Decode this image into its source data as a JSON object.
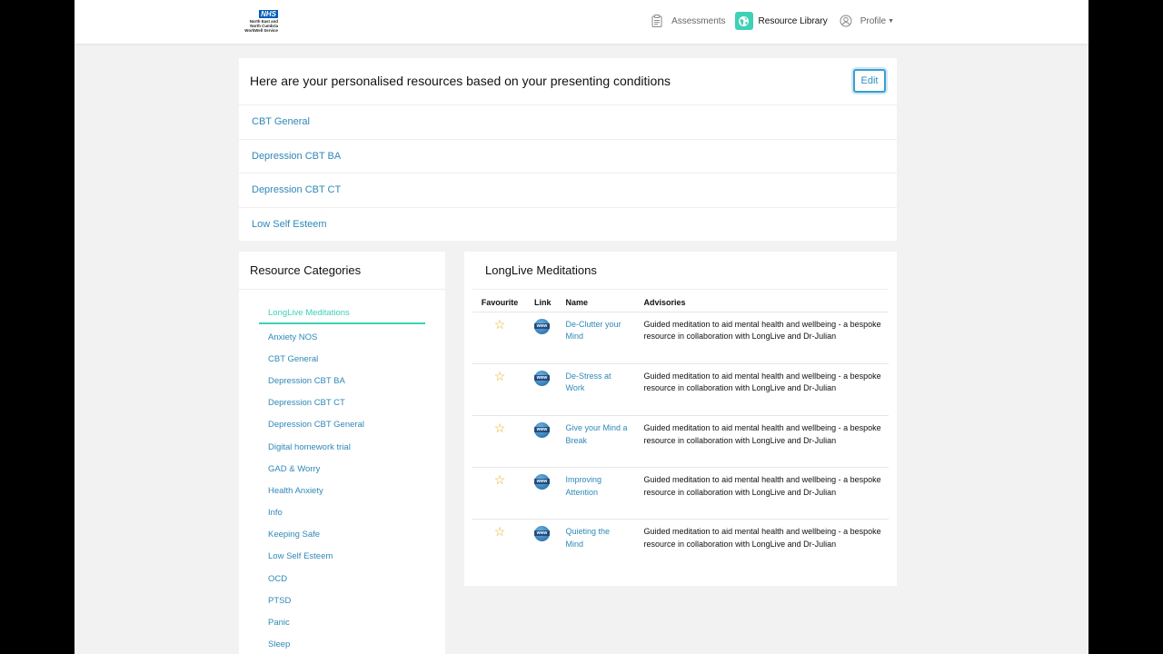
{
  "header": {
    "logo": {
      "nhs": "NHS",
      "org": "North East and North Cumbria WorkWell Service"
    },
    "nav": [
      {
        "label": "Assessments",
        "icon": "clipboard-icon",
        "active": false
      },
      {
        "label": "Resource Library",
        "icon": "globe-icon",
        "active": true
      },
      {
        "label": "Profile",
        "icon": "user-icon",
        "active": false
      }
    ]
  },
  "personalised": {
    "title": "Here are your personalised resources based on your presenting conditions",
    "edit_label": "Edit",
    "items": [
      "CBT General",
      "Depression CBT BA",
      "Depression CBT CT",
      "Low Self Esteem"
    ]
  },
  "categories": {
    "title": "Resource Categories",
    "items": [
      "LongLive Meditations",
      "Anxiety NOS",
      "CBT General",
      "Depression CBT BA",
      "Depression CBT CT",
      "Depression CBT General",
      "Digital homework trial",
      "GAD & Worry",
      "Health Anxiety",
      "Info",
      "Keeping Safe",
      "Low Self Esteem",
      "OCD",
      "PTSD",
      "Panic",
      "Sleep"
    ],
    "active_index": 0
  },
  "resources": {
    "title": "LongLive Meditations",
    "columns": {
      "favourite": "Favourite",
      "link": "Link",
      "name": "Name",
      "advisories": "Advisories"
    },
    "link_icon_text": "www",
    "rows": [
      {
        "name": "De-Clutter your Mind",
        "advisory": "Guided meditation to aid mental health and wellbeing - a bespoke resource in collaboration with LongLive and Dr-Julian"
      },
      {
        "name": "De-Stress at Work",
        "advisory": "Guided meditation to aid mental health and wellbeing - a bespoke resource in collaboration with LongLive and Dr-Julian"
      },
      {
        "name": "Give your Mind a Break",
        "advisory": "Guided meditation to aid mental health and wellbeing - a bespoke resource in collaboration with LongLive and Dr-Julian"
      },
      {
        "name": "Improving Attention",
        "advisory": "Guided meditation to aid mental health and wellbeing - a bespoke resource in collaboration with LongLive and Dr-Julian"
      },
      {
        "name": "Quieting the Mind",
        "advisory": "Guided meditation to aid mental health and wellbeing - a bespoke resource in collaboration with LongLive and Dr-Julian"
      }
    ]
  },
  "colors": {
    "accent": "#3ed1b6",
    "link": "#2e88b8",
    "star": "#e3b21f",
    "nhs": "#005eb8"
  }
}
